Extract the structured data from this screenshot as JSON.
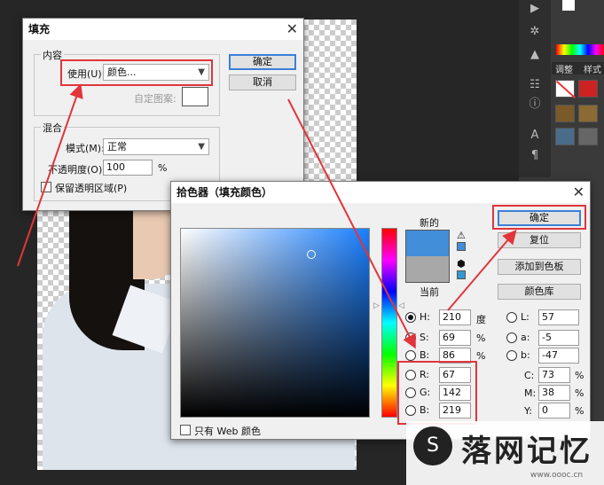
{
  "fill": {
    "title": "填充",
    "content_group": "内容",
    "use_label": "使用(U):",
    "use_value": "颜色...",
    "custom_pattern_label": "自定图案:",
    "ok": "确定",
    "cancel": "取消",
    "blend_group": "混合",
    "mode_label": "模式(M):",
    "mode_value": "正常",
    "opacity_label": "不透明度(O):",
    "opacity_value": "100",
    "opacity_unit": "%",
    "preserve_label": "保留透明区域(P)"
  },
  "picker": {
    "title": "拾色器（填充颜色）",
    "new_label": "新的",
    "current_label": "当前",
    "ok": "确定",
    "reset": "复位",
    "add_swatch": "添加到色板",
    "libraries": "颜色库",
    "web_only": "只有 Web 颜色",
    "new_color": "#438ed9",
    "current_color": "#a8a8a8",
    "hsb": [
      {
        "label": "H:",
        "value": "210",
        "unit": "度"
      },
      {
        "label": "S:",
        "value": "69",
        "unit": "%"
      },
      {
        "label": "B:",
        "value": "86",
        "unit": "%"
      }
    ],
    "rgb": [
      {
        "label": "R:",
        "value": "67"
      },
      {
        "label": "G:",
        "value": "142"
      },
      {
        "label": "B:",
        "value": "219"
      }
    ],
    "lab": [
      {
        "label": "L:",
        "value": "57"
      },
      {
        "label": "a:",
        "value": "-5"
      },
      {
        "label": "b:",
        "value": "-47"
      }
    ],
    "cmyk": [
      {
        "label": "C:",
        "value": "73",
        "unit": "%"
      },
      {
        "label": "M:",
        "value": "38",
        "unit": "%"
      },
      {
        "label": "Y:",
        "value": "0",
        "unit": "%"
      }
    ]
  },
  "right_panel": {
    "tab_adjust": "调整",
    "tab_style": "样式"
  },
  "watermark": {
    "text": "落网记忆",
    "url": "www.oooc.cn"
  },
  "colors": {
    "accent_red": "#e0353b",
    "default_button_border": "#3b7fd6"
  }
}
